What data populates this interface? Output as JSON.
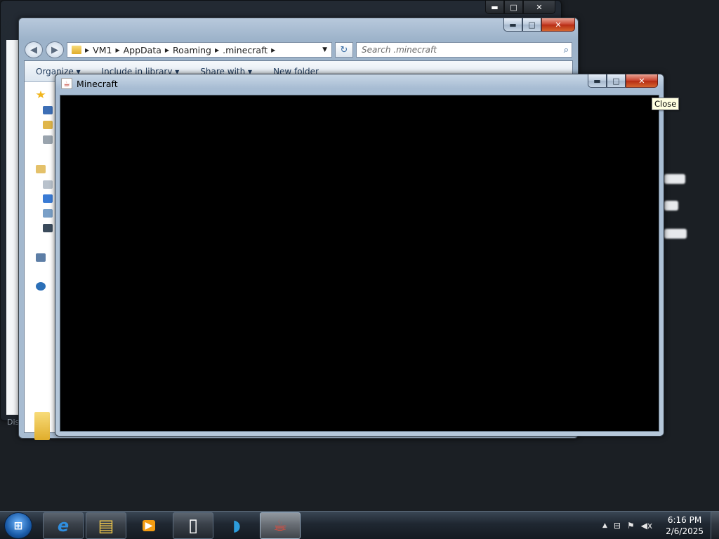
{
  "back_window": {
    "buttons": {
      "minimize": "▬",
      "maximize": "□",
      "close": "✕"
    },
    "partial_text": "Dis"
  },
  "explorer": {
    "buttons": {
      "minimize": "▬",
      "maximize": "□",
      "close": "✕"
    },
    "nav": {
      "back": "◀",
      "forward": "▶"
    },
    "address": {
      "segments": [
        "VM1",
        "AppData",
        "Roaming",
        ".minecraft"
      ],
      "separator": "▶",
      "dropdown": "▼"
    },
    "refresh": "↻",
    "search": {
      "placeholder": "Search .minecraft",
      "icon": "⌕"
    },
    "toolbar": {
      "organize": "Organize ▾",
      "include": "Include in library ▾",
      "share": "Share with ▾",
      "new_folder": "New folder"
    }
  },
  "minecraft_window": {
    "title": "Minecraft",
    "icon": "☕",
    "buttons": {
      "minimize": "▬",
      "maximize": "□",
      "close": "✕"
    }
  },
  "tooltip": {
    "text": "Close"
  },
  "taskbar": {
    "start_icon": "⊞",
    "items": [
      {
        "name": "internet-explorer",
        "glyph": "e",
        "color": "#2f8ee0"
      },
      {
        "name": "windows-explorer",
        "glyph": "▤",
        "color": "#f2c94c"
      },
      {
        "name": "media-player",
        "glyph": "▶",
        "color": "#f39c12"
      },
      {
        "name": "document",
        "glyph": "▯",
        "color": "#ffffff"
      },
      {
        "name": "dolphin",
        "glyph": "◗",
        "color": "#2d9cdb"
      },
      {
        "name": "java",
        "glyph": "☕",
        "color": "#e74c3c"
      }
    ],
    "tray": {
      "show_hidden": "▲",
      "network": "⊟",
      "action_center": "⚑",
      "volume": "◀x",
      "time": "6:16 PM",
      "date": "2/6/2025"
    }
  }
}
